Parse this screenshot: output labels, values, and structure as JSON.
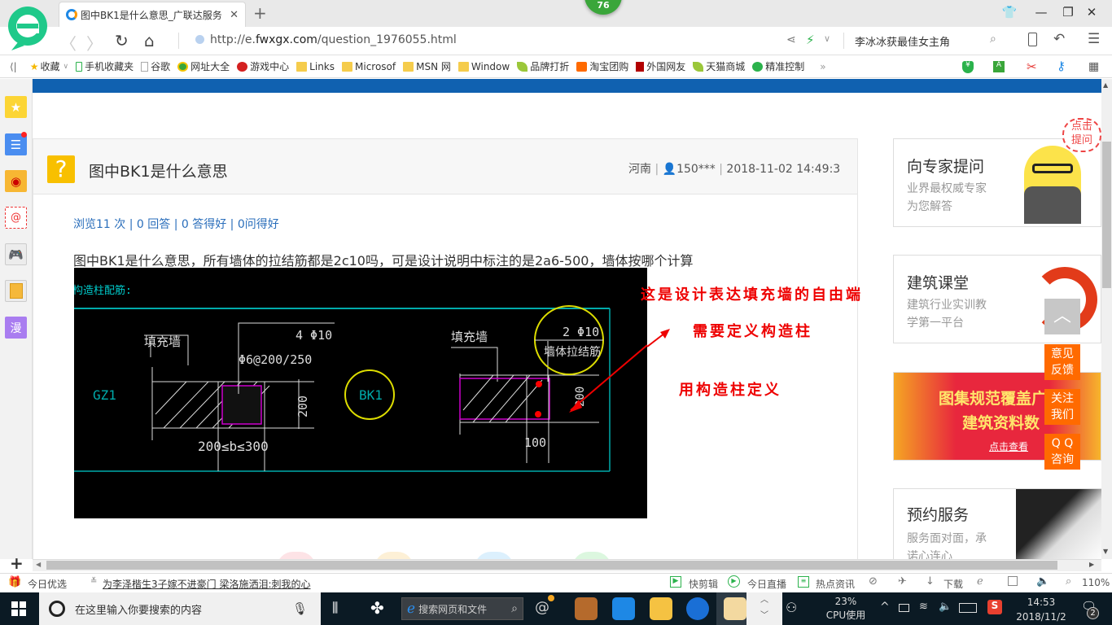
{
  "browser": {
    "tab_title": "图中BK1是什么意思_广联达服务",
    "notification_count": "76",
    "url_prefix": "http://e.",
    "url_domain": "fwxgx.com",
    "url_path": "/question_1976055.html",
    "search_query": "李冰冰获最佳女主角",
    "zoom_level": "110%"
  },
  "bookmarks": [
    {
      "label": "收藏",
      "icon": "star-icon"
    },
    {
      "label": "手机收藏夹",
      "icon": "phone-icon"
    },
    {
      "label": "谷歌",
      "icon": "page-icon"
    },
    {
      "label": "网址大全",
      "icon": "plus-globe-icon"
    },
    {
      "label": "游戏中心",
      "icon": "game-icon"
    },
    {
      "label": "Links",
      "icon": "folder-icon"
    },
    {
      "label": "Microsof",
      "icon": "folder-icon"
    },
    {
      "label": "MSN 网",
      "icon": "folder-icon"
    },
    {
      "label": "Window",
      "icon": "folder-icon"
    },
    {
      "label": "品牌打折",
      "icon": "leaf-icon"
    },
    {
      "label": "淘宝团购",
      "icon": "taobao-icon"
    },
    {
      "label": "外国网友",
      "icon": "bookmark-red-icon"
    },
    {
      "label": "天猫商城",
      "icon": "leaf-icon"
    },
    {
      "label": "精准控制",
      "icon": "wechat-icon"
    }
  ],
  "question": {
    "title": "图中BK1是什么意思",
    "region": "河南",
    "user": "150***",
    "datetime": "2018-11-02 14:49:3",
    "stats": "浏览11 次 | 0 回答 | 0 答得好 | 0问得好",
    "body": "图中BK1是什么意思，所有墙体的拉结筋都是2c10吗，可是设计说明中标注的是2a6-500，墙体按哪个计算"
  },
  "drawing": {
    "heading": "构造柱配筋:",
    "left_label_wall": "填充墙",
    "gz1": "GZ1",
    "rebar_main": "4 Φ10",
    "stirrup": "Φ6@200/250",
    "dim_200": "200",
    "dim_b": "200≤b≤300",
    "bk1": "BK1",
    "right_label_wall": "填充墙",
    "tie_bars": "2 Φ10",
    "tie_label": "墙体拉结筋",
    "dim_200b": "200",
    "dim_100": "100"
  },
  "annotations": [
    "这是设计表达填充墙的自由端",
    "需要定义构造柱",
    "用构造柱定义"
  ],
  "right_panel": {
    "expert": {
      "title": "向专家提问",
      "sub1": "业界最权威专家",
      "sub2": "为您解答",
      "bubble": "点击提问"
    },
    "course": {
      "title": "建筑课堂",
      "sub1": "建筑行业实训教",
      "sub2": "学第一平台"
    },
    "banner": {
      "line1": "图集规范覆盖广",
      "line2": "建筑资料数",
      "link": "点击查看"
    },
    "service": {
      "title": "预约服务",
      "sub1": "服务面对面，承",
      "sub2": "诺心连心"
    }
  },
  "float_buttons": [
    "意见\n反馈",
    "关注\n我们",
    "Q Q\n咨询"
  ],
  "float_labels": [
    [
      "意见",
      "反馈"
    ],
    [
      "关注",
      "我们"
    ],
    [
      "Q Q",
      "咨询"
    ]
  ],
  "statusbar": {
    "today_pick": "今日优选",
    "news": "为李泽楷生3子嫁不进豪门 梁洛施洒泪:刺我的心",
    "quick_edit": "快剪辑",
    "live": "今日直播",
    "hot_news": "热点资讯",
    "download": "下载"
  },
  "taskbar": {
    "search_placeholder": "在这里输入你要搜索的内容",
    "browser_search": "搜索网页和文件",
    "cpu_pct": "23%",
    "cpu_label": "CPU使用",
    "time": "14:53",
    "date": "2018/11/2",
    "notif_count": "2"
  }
}
